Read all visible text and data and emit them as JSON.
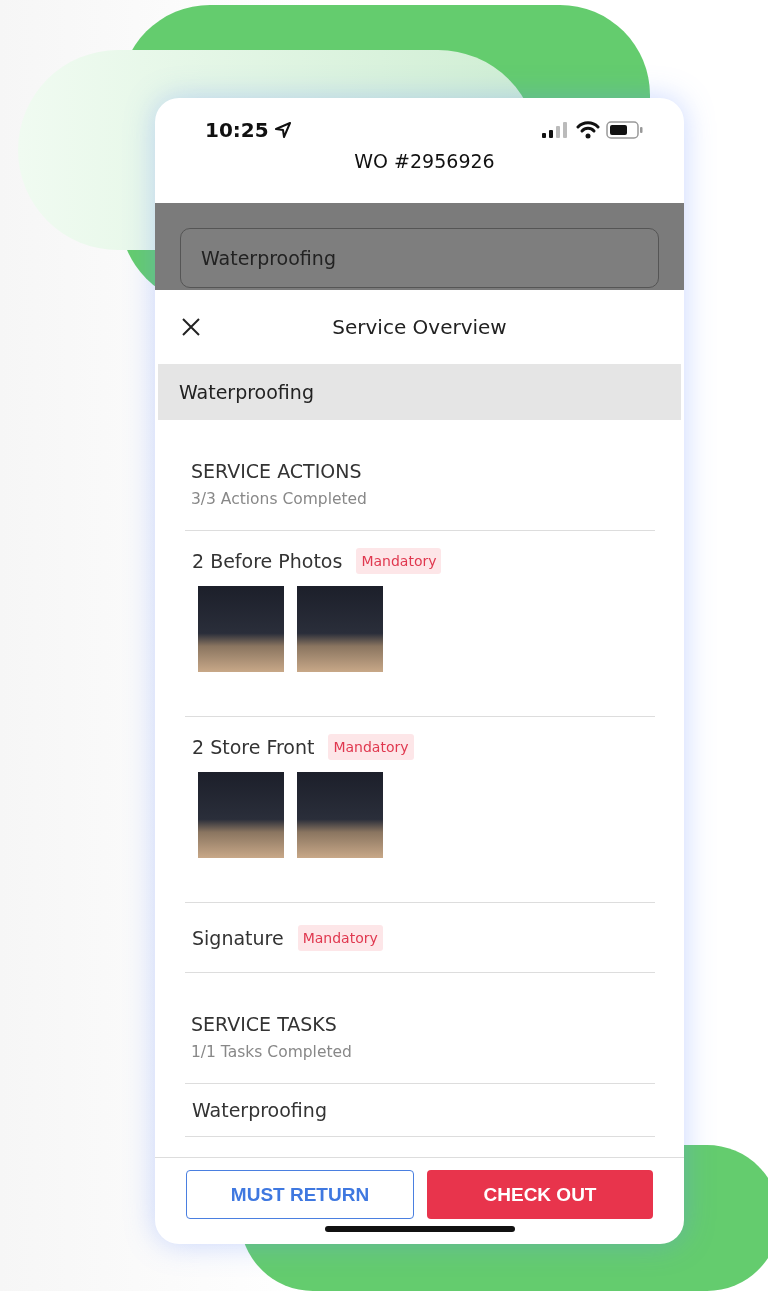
{
  "status_bar": {
    "time": "10:25"
  },
  "header": {
    "title": "WO #2956926"
  },
  "background_field": {
    "value": "Waterproofing"
  },
  "sheet": {
    "title": "Service Overview",
    "service_name": "Waterproofing",
    "sections": [
      {
        "heading": "SERVICE ACTIONS",
        "summary": "3/3 Actions Completed",
        "items": [
          {
            "kind": "photos",
            "label": "2 Before Photos",
            "badge": "Mandatory",
            "photos": [
              {
                "kind": "photo"
              },
              {
                "kind": "photo"
              }
            ]
          },
          {
            "kind": "photos",
            "label": "2 Store Front",
            "badge": "Mandatory",
            "photos": [
              {
                "kind": "photo"
              },
              {
                "kind": "photo"
              }
            ]
          },
          {
            "kind": "plain",
            "label": "Signature",
            "badge": "Mandatory"
          }
        ]
      },
      {
        "heading": "SERVICE TASKS",
        "summary": "1/1 Tasks Completed",
        "items": [
          {
            "kind": "plain",
            "label": "Waterproofing"
          }
        ]
      }
    ]
  },
  "buttons": [
    {
      "kind": "outline",
      "label": "MUST RETURN"
    },
    {
      "kind": "primary",
      "label": "CHECK OUT"
    }
  ]
}
